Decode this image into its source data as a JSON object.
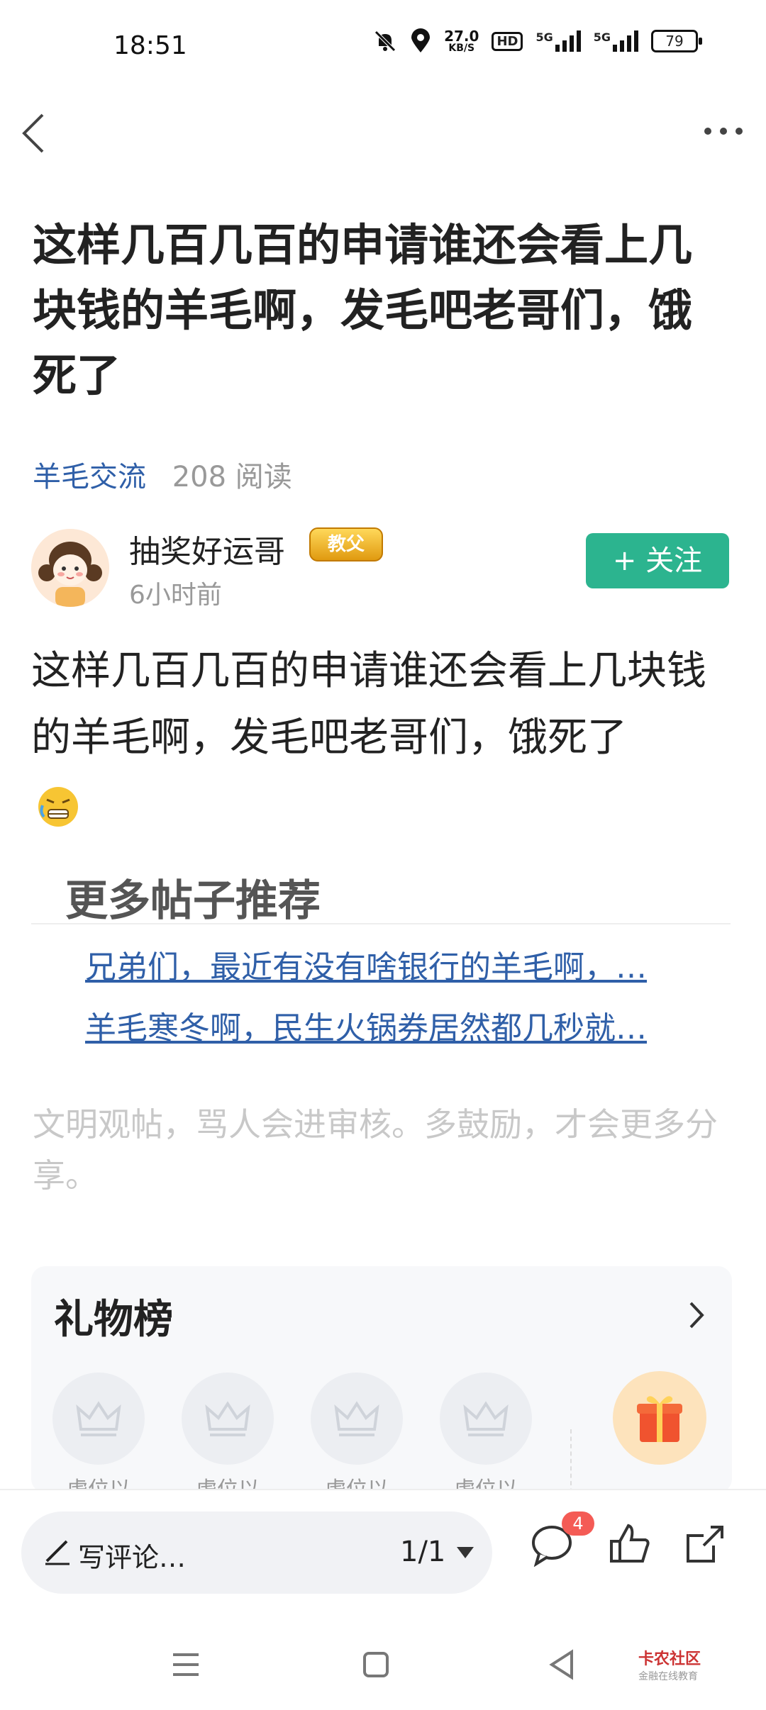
{
  "status_bar": {
    "time": "18:51",
    "speed_value": "27.0",
    "speed_unit": "KB/S",
    "hd_label": "HD",
    "network1": "5G",
    "network2": "5G",
    "battery": "79"
  },
  "header": {
    "back_icon": "back-arrow-icon",
    "more_icon": "more-dots-icon"
  },
  "post": {
    "title": "这样几百几百的申请谁还会看上几块钱的羊毛啊，发毛吧老哥们，饿死了",
    "category": "羊毛交流",
    "reads": "208 阅读",
    "author": {
      "name": "抽奖好运哥",
      "badge": "教父",
      "time": "6小时前",
      "follow_label": "+ 关注"
    },
    "body": "这样几百几百的申请谁还会看上几块钱的羊毛啊，发毛吧老哥们，饿死了",
    "emoji": "grimacing-face-icon"
  },
  "recommend": {
    "title": "更多帖子推荐",
    "links": [
      "兄弟们，最近有没有啥银行的羊毛啊，…",
      "羊毛寒冬啊，民生火锅券居然都几秒就…"
    ]
  },
  "notice": "文明观帖，骂人会进审核。多鼓励，才会更多分享。",
  "gift_board": {
    "title": "礼物榜",
    "slots": [
      "虚位以",
      "虚位以",
      "虚位以",
      "虚位以"
    ]
  },
  "bottom_bar": {
    "comment_placeholder": "写评论…",
    "pager": "1/1",
    "comment_count": "4"
  },
  "watermark": {
    "name": "卡农社区",
    "sub": "金融在线教育"
  },
  "colors": {
    "accent_green": "#2cb48f",
    "link_blue": "#2f5fa8",
    "badge_red": "#f45b55"
  }
}
